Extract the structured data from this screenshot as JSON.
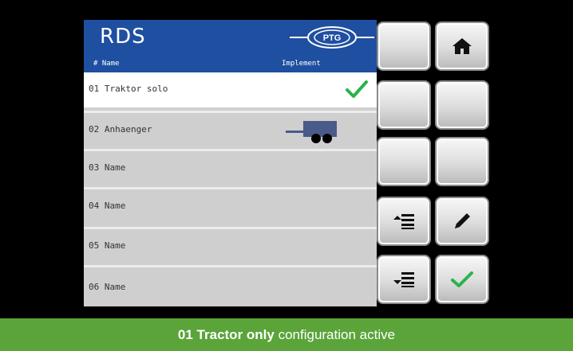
{
  "header": {
    "title": "RDS",
    "logo_text": "PTG",
    "col_name": "# Name",
    "col_implement": "Implement",
    "colors": {
      "header_bg": "#1f4fa0",
      "check": "#2bb24c"
    }
  },
  "rows": [
    {
      "label": "01 Traktor solo",
      "selected": true,
      "implement_icon": "check-icon"
    },
    {
      "label": "02 Anhaenger",
      "selected": false,
      "implement_icon": "trailer-icon"
    },
    {
      "label": "03 Name",
      "selected": false
    },
    {
      "label": "04 Name",
      "selected": false
    },
    {
      "label": "05 Name",
      "selected": false
    },
    {
      "label": "06 Name",
      "selected": false
    }
  ],
  "softkeys": [
    {
      "name": "blank",
      "icon": ""
    },
    {
      "name": "home",
      "icon": "home-icon"
    },
    {
      "name": "blank",
      "icon": ""
    },
    {
      "name": "blank",
      "icon": ""
    },
    {
      "name": "blank",
      "icon": ""
    },
    {
      "name": "blank",
      "icon": ""
    },
    {
      "name": "move-up",
      "icon": "list-up-icon"
    },
    {
      "name": "edit",
      "icon": "pencil-icon"
    },
    {
      "name": "move-down",
      "icon": "list-down-icon"
    },
    {
      "name": "confirm",
      "icon": "check-icon"
    }
  ],
  "status": {
    "bold": "01 Tractor only",
    "rest": " configuration active",
    "color": "#5aa43a"
  }
}
